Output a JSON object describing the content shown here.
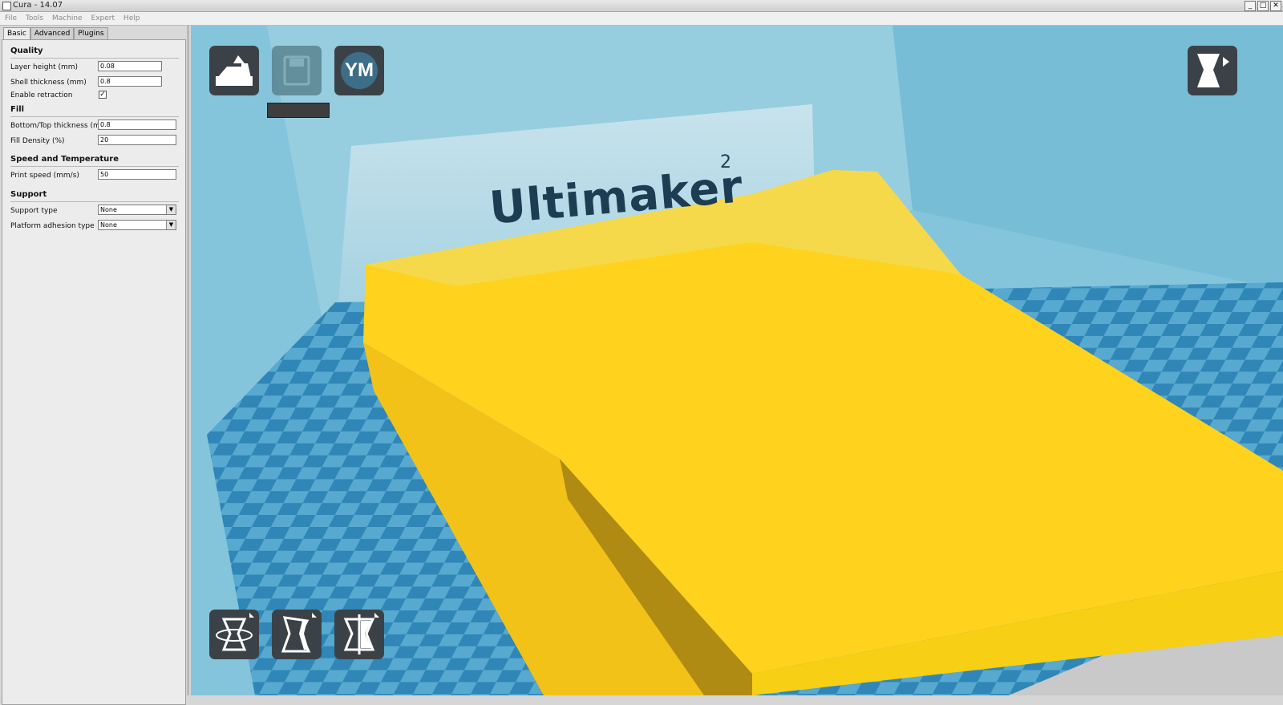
{
  "window": {
    "title": "Cura - 14.07",
    "controls": [
      "_",
      "□",
      "✕"
    ]
  },
  "menu": [
    "File",
    "Tools",
    "Machine",
    "Expert",
    "Help"
  ],
  "tabs": [
    "Basic",
    "Advanced",
    "Plugins"
  ],
  "sections": {
    "quality": {
      "title": "Quality",
      "layer_height_label": "Layer height (mm)",
      "layer_height": "0.08",
      "shell_thickness_label": "Shell thickness (mm)",
      "shell_thickness": "0.8",
      "enable_retraction_label": "Enable retraction",
      "enable_retraction": "✓"
    },
    "fill": {
      "title": "Fill",
      "bottom_top_label": "Bottom/Top thickness (mm)",
      "bottom_top": "0.8",
      "fill_density_label": "Fill Density (%)",
      "fill_density": "20"
    },
    "speed": {
      "title": "Speed and Temperature",
      "print_speed_label": "Print speed (mm/s)",
      "print_speed": "50"
    },
    "support": {
      "title": "Support",
      "support_type_label": "Support type",
      "support_type": "None",
      "adhesion_label": "Platform adhesion type",
      "adhesion": "None"
    }
  },
  "viewport": {
    "brand": "Ultimaker",
    "brand_sup": "2",
    "youmagine_label": "YM",
    "model_color": "#ffd21e"
  }
}
